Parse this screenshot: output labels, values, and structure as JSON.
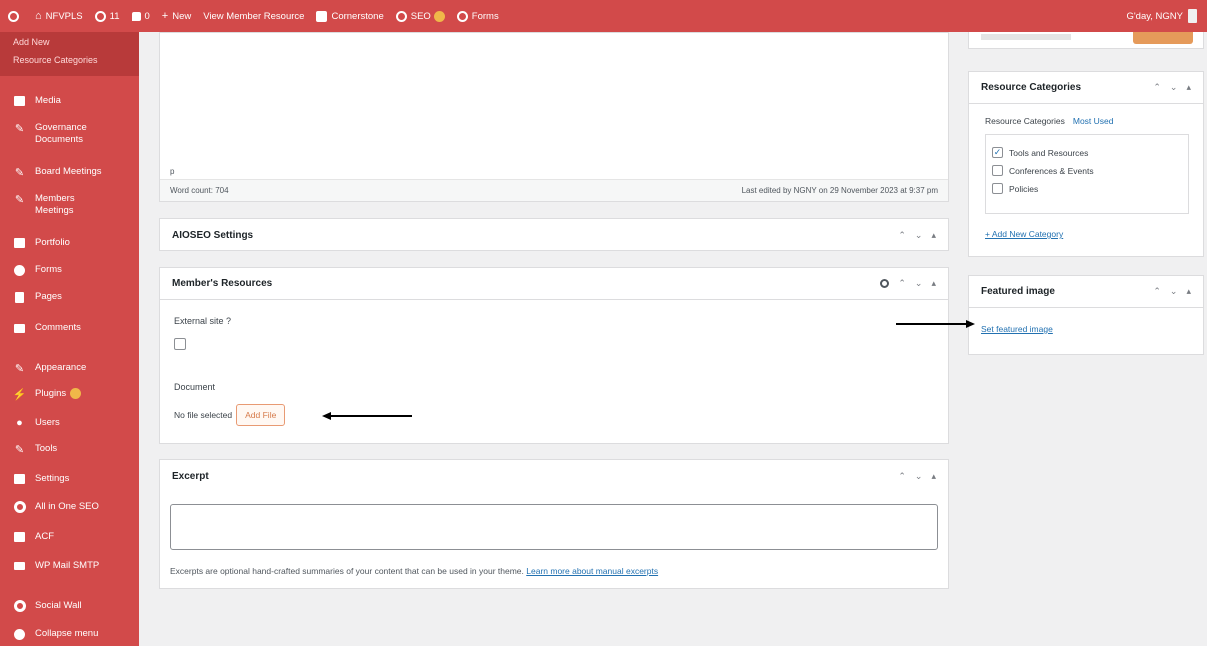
{
  "adminbar": {
    "site_name": "NFVPLS",
    "updates_count": "11",
    "comments_count": "0",
    "new_label": "New",
    "view_label": "View Member Resource",
    "cornerstone_label": "Cornerstone",
    "seo_label": "SEO",
    "forms_label": "Forms",
    "greeting": "G'day, NGNY"
  },
  "sidebar": {
    "submenu": [
      "Add New",
      "Resource Categories"
    ],
    "items": [
      {
        "label": "Media",
        "icon": "media-icon"
      },
      {
        "label": "Governance Documents",
        "icon": "pin-icon"
      },
      {
        "label": "Board Meetings",
        "icon": "pin-icon"
      },
      {
        "label": "Members Meetings",
        "icon": "pin-icon"
      },
      {
        "label": "Portfolio",
        "icon": "portfolio-icon"
      },
      {
        "label": "Forms",
        "icon": "forms-icon"
      },
      {
        "label": "Pages",
        "icon": "pages-icon"
      },
      {
        "label": "Comments",
        "icon": "comments-icon"
      },
      {
        "label": "Appearance",
        "icon": "brush-icon"
      },
      {
        "label": "Plugins",
        "icon": "plug-icon"
      },
      {
        "label": "Users",
        "icon": "users-icon"
      },
      {
        "label": "Tools",
        "icon": "wrench-icon"
      },
      {
        "label": "Settings",
        "icon": "settings-icon"
      },
      {
        "label": "All in One SEO",
        "icon": "seo-icon"
      },
      {
        "label": "ACF",
        "icon": "acf-icon"
      },
      {
        "label": "WP Mail SMTP",
        "icon": "mail-icon"
      },
      {
        "label": "Social Wall",
        "icon": "social-icon"
      },
      {
        "label": "Collapse menu",
        "icon": "collapse-icon"
      }
    ]
  },
  "editor": {
    "path": "p",
    "word_count": "Word count: 704",
    "last_edited": "Last edited by NGNY on 29 November 2023 at 9:37 pm"
  },
  "aioseo": {
    "title": "AIOSEO Settings"
  },
  "members": {
    "title": "Member's Resources",
    "external_label": "External site ?",
    "document_label": "Document",
    "no_file": "No file selected",
    "add_file": "Add File"
  },
  "excerpt": {
    "title": "Excerpt",
    "help": "Excerpts are optional hand-crafted summaries of your content that can be used in your theme.",
    "help_link": "Learn more about manual excerpts"
  },
  "rescat": {
    "title": "Resource Categories",
    "tab_all": "Resource Categories",
    "tab_used": "Most Used",
    "categories": [
      {
        "label": "Tools and Resources",
        "checked": true
      },
      {
        "label": "Conferences & Events",
        "checked": false
      },
      {
        "label": "Policies",
        "checked": false
      }
    ],
    "add_new": "+ Add New Category"
  },
  "featured": {
    "title": "Featured image",
    "set_link": "Set featured image"
  },
  "colors": {
    "brand": "#d24a4a",
    "link": "#2271b1",
    "accent": "#e59a5a"
  }
}
